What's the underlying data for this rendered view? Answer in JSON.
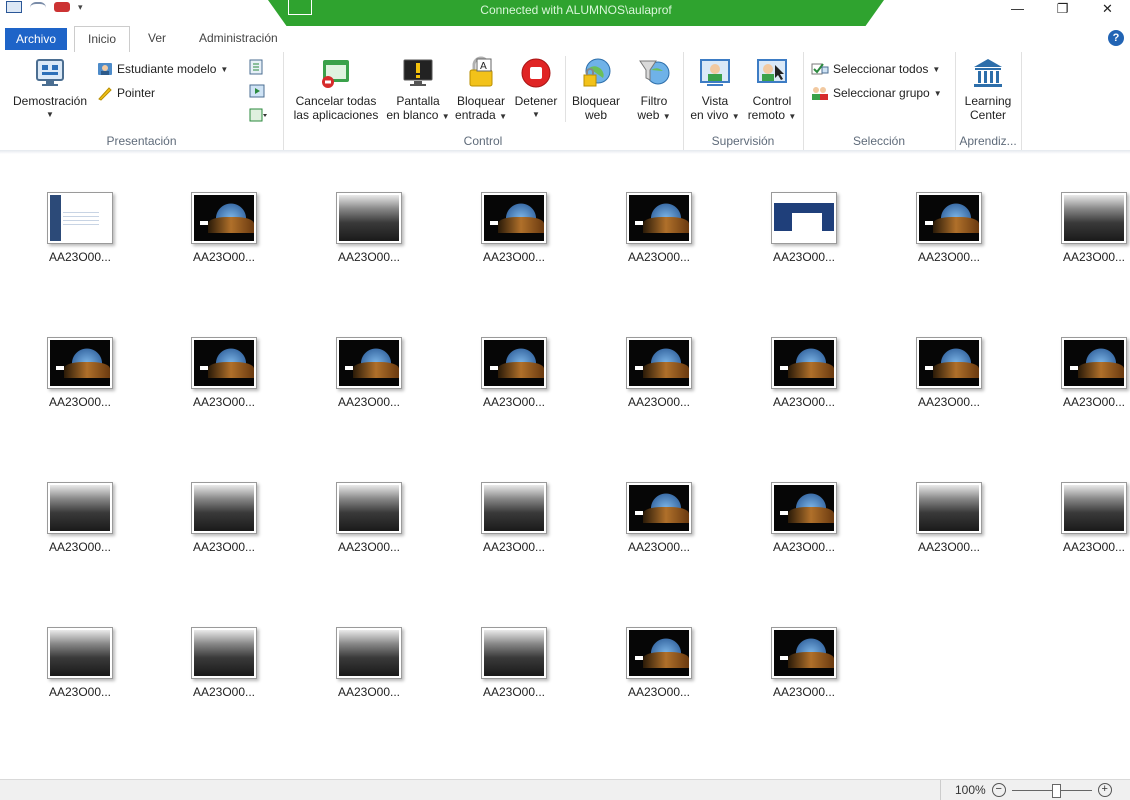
{
  "window": {
    "connection_text": "Connected with ALUMNOS\\aulaprof",
    "minimize": "—",
    "restore": "❐",
    "close": "✕",
    "help": "?"
  },
  "tabs": [
    "Archivo",
    "Inicio",
    "Ver",
    "Administración"
  ],
  "ribbon": {
    "presentacion": {
      "label": "Presentación",
      "demostracion": "Demostración",
      "estudiante_modelo": "Estudiante modelo",
      "pointer": "Pointer"
    },
    "control": {
      "label": "Control",
      "cancelar_line1": "Cancelar todas",
      "cancelar_line2": "las aplicaciones",
      "pantalla_line1": "Pantalla",
      "pantalla_line2": "en blanco",
      "bloquear_line1": "Bloquear",
      "bloquear_line2": "entrada",
      "detener": "Detener",
      "bloquear_web_line1": "Bloquear",
      "bloquear_web_line2": "web",
      "filtro_line1": "Filtro",
      "filtro_line2": "web"
    },
    "supervision": {
      "label": "Supervisión",
      "vista_line1": "Vista",
      "vista_line2": "en vivo",
      "control_line1": "Control",
      "control_line2": "remoto"
    },
    "seleccion": {
      "label": "Selección",
      "todos": "Seleccionar todos",
      "grupo": "Seleccionar grupo"
    },
    "aprendizaje": {
      "label": "Aprendiz...",
      "lc_line1": "Learning",
      "lc_line2": "Center"
    }
  },
  "computers": [
    {
      "label": "AA23O00...",
      "screen": "app1"
    },
    {
      "label": "AA23O00...",
      "screen": "win"
    },
    {
      "label": "AA23O00...",
      "screen": "gray"
    },
    {
      "label": "AA23O00...",
      "screen": "win"
    },
    {
      "label": "AA23O00...",
      "screen": "win"
    },
    {
      "label": "AA23O00...",
      "screen": "app2"
    },
    {
      "label": "AA23O00...",
      "screen": "win"
    },
    {
      "label": "AA23O00...",
      "screen": "gray"
    },
    {
      "label": "AA23O00...",
      "screen": "win"
    },
    {
      "label": "AA23O00...",
      "screen": "win"
    },
    {
      "label": "AA23O00...",
      "screen": "win"
    },
    {
      "label": "AA23O00...",
      "screen": "win"
    },
    {
      "label": "AA23O00...",
      "screen": "win"
    },
    {
      "label": "AA23O00...",
      "screen": "win"
    },
    {
      "label": "AA23O00...",
      "screen": "win"
    },
    {
      "label": "AA23O00...",
      "screen": "win"
    },
    {
      "label": "AA23O00...",
      "screen": "gray"
    },
    {
      "label": "AA23O00...",
      "screen": "gray"
    },
    {
      "label": "AA23O00...",
      "screen": "gray"
    },
    {
      "label": "AA23O00...",
      "screen": "gray"
    },
    {
      "label": "AA23O00...",
      "screen": "win"
    },
    {
      "label": "AA23O00...",
      "screen": "win"
    },
    {
      "label": "AA23O00...",
      "screen": "gray"
    },
    {
      "label": "AA23O00...",
      "screen": "gray"
    },
    {
      "label": "AA23O00...",
      "screen": "gray"
    },
    {
      "label": "AA23O00...",
      "screen": "gray"
    },
    {
      "label": "AA23O00...",
      "screen": "gray"
    },
    {
      "label": "AA23O00...",
      "screen": "gray"
    },
    {
      "label": "AA23O00...",
      "screen": "win"
    },
    {
      "label": "AA23O00...",
      "screen": "win"
    }
  ],
  "status": {
    "zoom": "100%",
    "zoom_out": "−",
    "zoom_in": "+"
  }
}
